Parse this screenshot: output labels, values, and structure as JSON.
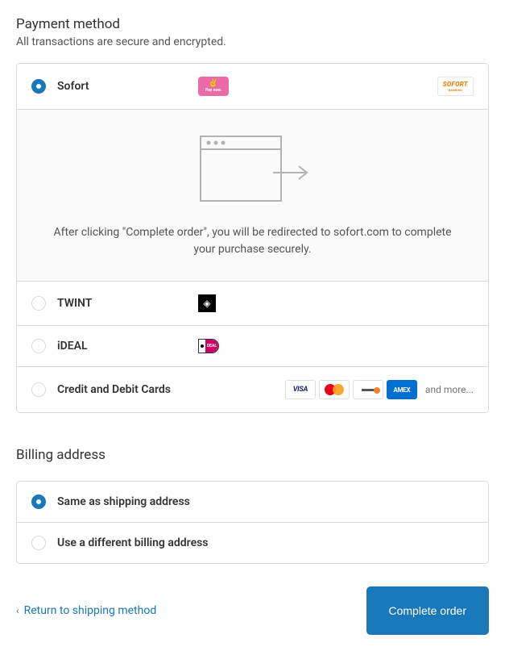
{
  "payment": {
    "title": "Payment method",
    "subtitle": "All transactions are secure and encrypted.",
    "options": {
      "sofort": {
        "label": "Sofort",
        "pay_now_text": "Pay now."
      },
      "twint": {
        "label": "TWINT"
      },
      "ideal": {
        "label": "iDEAL",
        "badge_text": "DEAL"
      },
      "cards": {
        "label": "Credit and Debit Cards",
        "more_text": "and more..."
      }
    },
    "redirect_text": "After clicking \"Complete order\", you will be redirected to sofort.com to complete your purchase securely.",
    "brands": {
      "visa": "VISA",
      "amex": "AMEX",
      "sofort": "SOFORT",
      "sofort_sub": "BANKING"
    }
  },
  "billing": {
    "title": "Billing address",
    "same": "Same as shipping address",
    "different": "Use a different billing address"
  },
  "footer": {
    "return_text": "Return to shipping method",
    "complete_button": "Complete order"
  }
}
